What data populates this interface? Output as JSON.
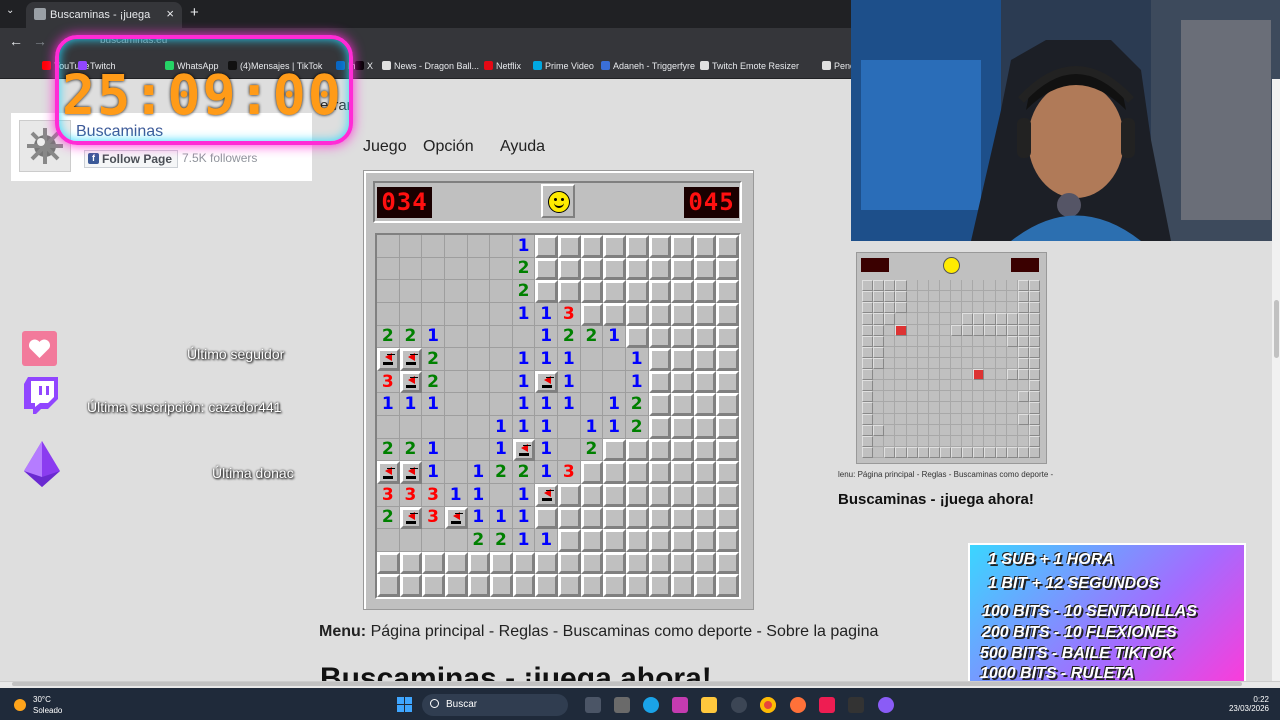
{
  "browser": {
    "tab_title": "Buscaminas - ¡juega ahora!",
    "tab_close": "×",
    "new_tab": "+",
    "tab_menu": "⌄",
    "back": "←",
    "forward": "→",
    "url": "buscaminas.eu",
    "bookmarks": [
      {
        "label": "YouTube",
        "color": "#ff0000"
      },
      {
        "label": "Twitch",
        "color": "#9146ff"
      },
      {
        "label": "WhatsApp",
        "color": "#25d366"
      },
      {
        "label": "(4)Mensajes | TikTok",
        "color": "#111111"
      },
      {
        "label": "In",
        "color": "#0a66c2"
      },
      {
        "label": "X",
        "color": "#000000"
      },
      {
        "label": "News - Dragon Ball...",
        "color": "#e0e0e0"
      },
      {
        "label": "Netflix",
        "color": "#e50914"
      },
      {
        "label": "Prime Video",
        "color": "#00a8e1"
      },
      {
        "label": "Adaneh - Triggerfyre",
        "color": "#3a6fd8"
      },
      {
        "label": "Twitch Emote Resizer",
        "color": "#e0e0e0"
      },
      {
        "label": "Penc",
        "color": "#e0e0e0"
      }
    ]
  },
  "page": {
    "close_label": "errar",
    "menus": [
      "Juego",
      "Opción",
      "Ayuda"
    ],
    "game": {
      "mines_counter": "034",
      "timer": "045",
      "rows": [
        "------1.........",
        "------2.........",
        "------2.........",
        "------113.......",
        "221----1221.....",
        "FF2---111--1....",
        "3F2---1F1--1....",
        "111---111-12....",
        "-----111-112....",
        "221--1F1-2......",
        "FF1-12213.......",
        "33311-1F........",
        "2F3F111.........",
        "----2211........",
        "................",
        "................"
      ]
    },
    "footer_menu_label": "Menu:",
    "footer_menu_links": "Página principal - Reglas - Buscaminas como deporte - Sobre la pagina",
    "big_title": "Buscaminas - ¡juega ahora!"
  },
  "mini_screenshot": {
    "menu_text": "lenu: Página principal - Reglas - Buscaminas como deporte -",
    "title": "Buscaminas - ¡juega ahora!"
  },
  "overlay": {
    "timer": "25:09:00",
    "facebook": {
      "name": "Buscaminas",
      "follow": "Follow Page",
      "followers": "7.5K followers"
    },
    "alerts": {
      "follower": "Último seguidor",
      "subscription": "Última suscripción: cazador441",
      "donation": "Última donac"
    },
    "promo": [
      "1 SUB + 1 HORA",
      "1 BIT + 12 SEGUNDOS",
      "100 BITS - 10 SENTADILLAS",
      "200 BITS - 10 FLEXIONES",
      "500 BITS - BAILE TIKTOK",
      "1000 BITS - RULETA"
    ]
  },
  "taskbar": {
    "temperature": "30°C",
    "weather": "Soleado",
    "search_placeholder": "Buscar",
    "time": "0:22",
    "date": "23/03/2026"
  },
  "colors": {
    "n1": "#0000ff",
    "n2": "#008000",
    "n3": "#ff0000",
    "lcd": "#ff1010",
    "timer_glow": "#ff2bd6",
    "timer_text": "#ff9b18"
  }
}
